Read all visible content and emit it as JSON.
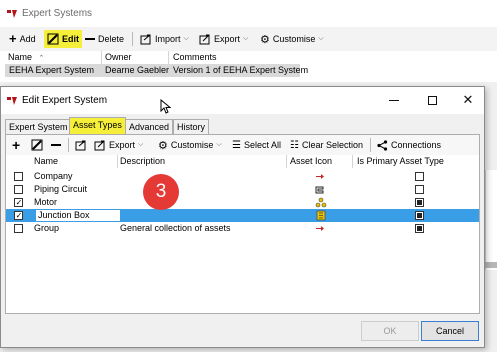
{
  "background_window": {
    "title": "Expert Systems",
    "toolbar": {
      "add": "Add",
      "edit": "Edit",
      "delete": "Delete",
      "import": "Import",
      "export": "Export",
      "customise": "Customise"
    },
    "columns": [
      "Name",
      "Owner",
      "Comments"
    ],
    "row": {
      "name": "EEHA Expert System",
      "owner": "Dearne Gaebler",
      "comments": "Version 1 of EEHA Expert System"
    }
  },
  "dialog": {
    "title": "Edit Expert System",
    "tabs": [
      "Expert System",
      "Asset Types",
      "Advanced",
      "History"
    ],
    "active_tab": "Asset Types",
    "toolbar": {
      "export": "Export",
      "customise": "Customise",
      "select_all": "Select All",
      "clear_selection": "Clear Selection",
      "connections": "Connections"
    },
    "columns": {
      "name": "Name",
      "description": "Description",
      "asset_icon": "Asset Icon",
      "is_primary": "Is Primary Asset Type"
    },
    "rows": [
      {
        "name": "Company",
        "description": "",
        "checked": false,
        "primary": false,
        "icon": "red-arrow-icon"
      },
      {
        "name": "Piping Circuit",
        "description": "",
        "checked": false,
        "primary": false,
        "icon": "pipe-icon"
      },
      {
        "name": "Motor",
        "description": "",
        "checked": true,
        "primary": true,
        "icon": "motor-icon"
      },
      {
        "name": "Junction Box",
        "description": "",
        "checked": true,
        "primary": true,
        "icon": "junction-box-icon"
      },
      {
        "name": "Group",
        "description": "General collection of assets",
        "checked": false,
        "primary": true,
        "icon": "red-arrow-icon"
      }
    ],
    "selected_row": "Junction Box",
    "ok": "OK",
    "cancel": "Cancel"
  },
  "callout_number": "3",
  "colors": {
    "highlight": "#f5ef3a",
    "selection": "#3a9ee6",
    "badge": "#e53935"
  }
}
